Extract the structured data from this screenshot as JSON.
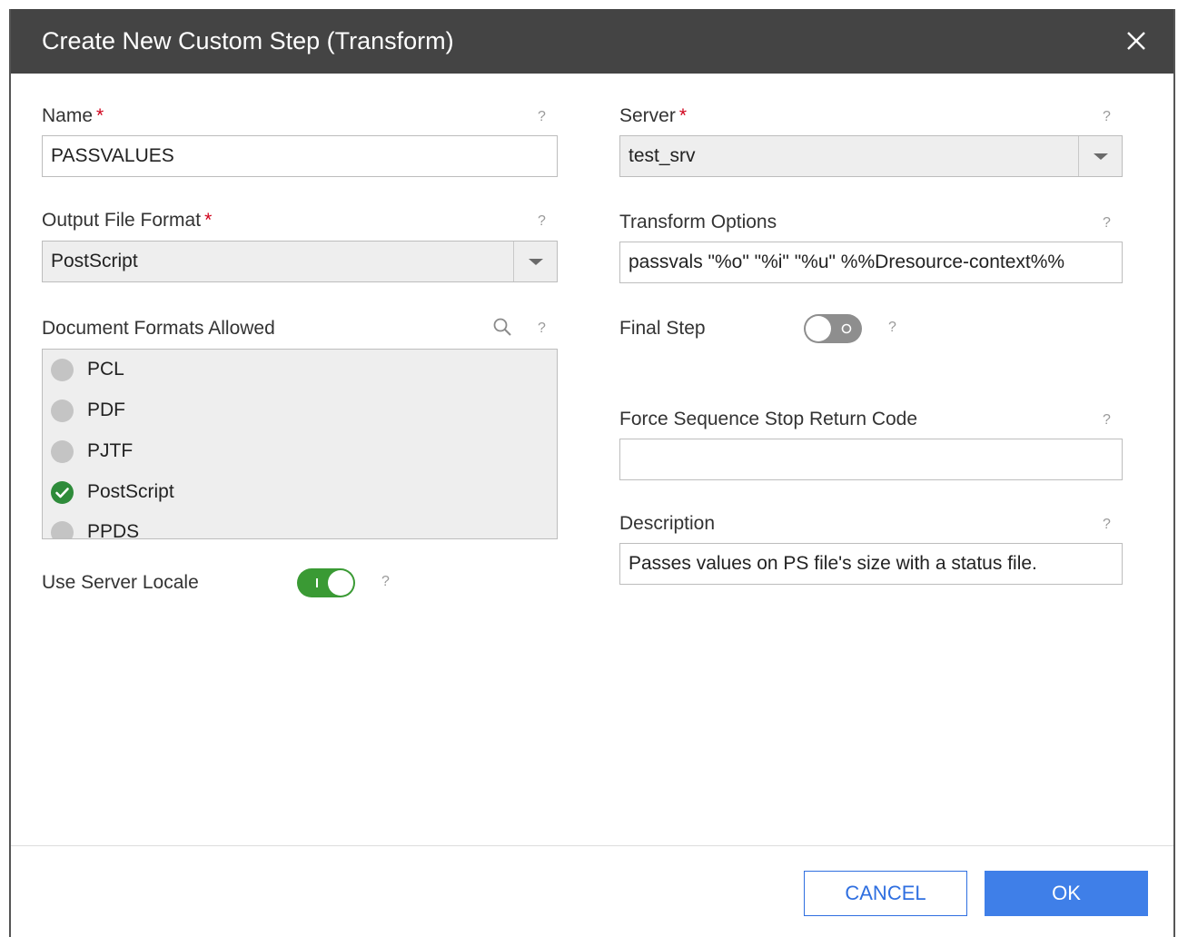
{
  "dialog": {
    "title": "Create New Custom Step (Transform)"
  },
  "fields": {
    "name": {
      "label": "Name",
      "required_mark": "*",
      "value": "PASSVALUES",
      "help": "?"
    },
    "output_format": {
      "label": "Output File Format",
      "required_mark": "*",
      "value": "PostScript",
      "help": "?"
    },
    "doc_formats": {
      "label": "Document Formats Allowed",
      "help": "?",
      "items": [
        {
          "label": "PCL",
          "selected": false
        },
        {
          "label": "PDF",
          "selected": false
        },
        {
          "label": "PJTF",
          "selected": false
        },
        {
          "label": "PostScript",
          "selected": true
        },
        {
          "label": "PPDS",
          "selected": false
        }
      ]
    },
    "use_server_locale": {
      "label": "Use Server Locale",
      "state": "on",
      "help": "?"
    },
    "server": {
      "label": "Server",
      "required_mark": "*",
      "value": "test_srv",
      "help": "?"
    },
    "transform_options": {
      "label": "Transform Options",
      "value": "passvals \"%o\" \"%i\" \"%u\" %%Dresource-context%%",
      "help": "?"
    },
    "final_step": {
      "label": "Final Step",
      "state": "off",
      "help": "?"
    },
    "force_stop_code": {
      "label": "Force Sequence Stop Return Code",
      "value": "",
      "help": "?"
    },
    "description": {
      "label": "Description",
      "value": "Passes values on PS file's size with a status file.",
      "help": "?"
    }
  },
  "buttons": {
    "cancel": "CANCEL",
    "ok": "OK"
  },
  "colors": {
    "titlebar": "#444444",
    "required": "#d0021b",
    "toggle_on": "#3a9a34",
    "primary": "#3f7fe8"
  }
}
